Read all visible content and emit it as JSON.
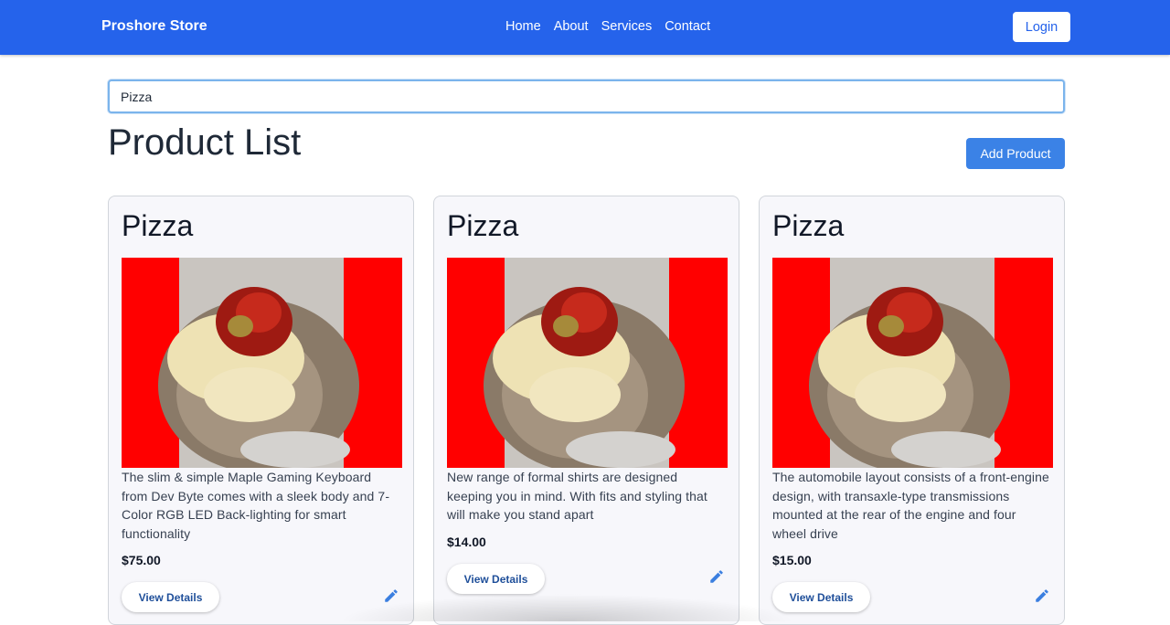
{
  "nav": {
    "brand": "Proshore Store",
    "links": [
      "Home",
      "About",
      "Services",
      "Contact"
    ],
    "login_label": "Login"
  },
  "search": {
    "value": "Pizza"
  },
  "page": {
    "title": "Product List",
    "add_label": "Add Product"
  },
  "products": [
    {
      "title": "Pizza",
      "description": "The slim & simple Maple Gaming Keyboard from Dev Byte comes with a sleek body and 7-Color RGB LED Back-lighting for smart functionality",
      "price": "$75.00",
      "view_label": "View Details",
      "edit_icon": "pencil-icon"
    },
    {
      "title": "Pizza",
      "description": "New range of formal shirts are designed keeping you in mind. With fits and styling that will make you stand apart",
      "price": "$14.00",
      "view_label": "View Details",
      "edit_icon": "pencil-icon"
    },
    {
      "title": "Pizza",
      "description": "The automobile layout consists of a front-engine design, with transaxle-type transmissions mounted at the rear of the engine and four wheel drive",
      "price": "$15.00",
      "view_label": "View Details",
      "edit_icon": "pencil-icon"
    }
  ],
  "colors": {
    "navbar": "#2563eb",
    "accent": "#3b82e6",
    "image_border": "#ff0000"
  }
}
